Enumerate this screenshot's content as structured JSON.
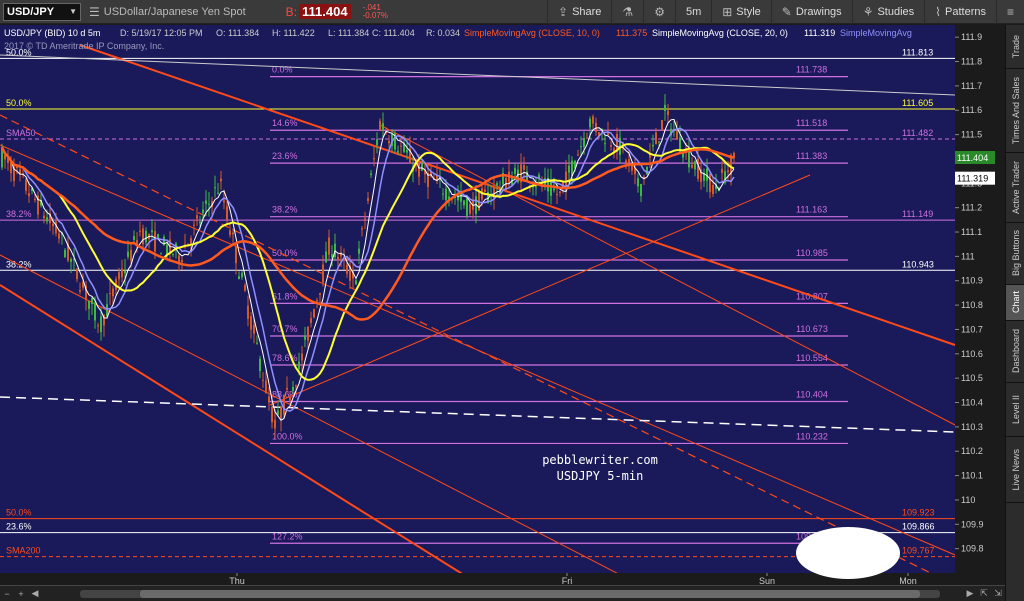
{
  "toolbar": {
    "symbol": "USD/JPY",
    "description": "USDollar/Japanese Yen Spot",
    "bid_label": "B:",
    "bid_value": "111.404",
    "change_net": "-.041",
    "change_pct": "-0.07%",
    "share_label": "Share",
    "timeframe_label": "5m",
    "style_label": "Style",
    "drawings_label": "Drawings",
    "studies_label": "Studies",
    "patterns_label": "Patterns",
    "icons": [
      "menu-icon",
      "share-icon",
      "flask-icon",
      "gear-icon",
      "style-icon",
      "pencil-icon",
      "studies-icon",
      "patterns-icon"
    ]
  },
  "chart": {
    "header": {
      "symbol": "USD/JPY (BID) 10 d 5m",
      "date": "D: 5/19/17 12:05 PM",
      "open": "O: 111.384",
      "high": "H: 111.422",
      "low": "L: 111.384",
      "close": "C: 111.404",
      "range": "R: 0.034",
      "sma10": "SimpleMovingAvg (CLOSE, 10, 0)",
      "sma10_value": "111.375",
      "sma20": "SimpleMovingAvg (CLOSE, 20, 0)",
      "sma20_value": "111.319",
      "sma_more": "SimpleMovingAvg"
    },
    "copyright": "2017 © TD Ameritrade IP Company, Inc.",
    "watermark_line1": "pebblewriter.com",
    "watermark_line2": "USDJPY 5-min",
    "colors": {
      "background": "#1a1a5a",
      "up_candle": "#3fb83f",
      "down_candle": "#d45a26",
      "sma10": "#ffffff",
      "sma20": "#9090ff",
      "sma50": "#ffff33",
      "sma200": "#ff5a1f",
      "fib": "#d070e0",
      "orange_lines": "#ff4a1a"
    },
    "y_axis": {
      "min": 109.7,
      "max": 111.95,
      "ticks": [
        "111.9",
        "111.8",
        "111.7",
        "111.6",
        "111.5",
        "111.4",
        "111.3",
        "111.2",
        "111.1",
        "111",
        "110.9",
        "110.8",
        "110.7",
        "110.6",
        "110.5",
        "110.4",
        "110.3",
        "110.2",
        "110.1",
        "110",
        "109.9",
        "109.8"
      ],
      "tick_values": [
        111.9,
        111.8,
        111.7,
        111.6,
        111.5,
        111.4,
        111.3,
        111.2,
        111.1,
        111.0,
        110.9,
        110.8,
        110.7,
        110.6,
        110.5,
        110.4,
        110.3,
        110.2,
        110.1,
        110.0,
        109.9,
        109.8
      ],
      "current_price": "111.404",
      "current_price_value": 111.404,
      "sma_price": "111.319",
      "sma_price_value": 111.319
    },
    "x_axis": {
      "labels": [
        "Thu",
        "Fri",
        "Sun",
        "Mon"
      ]
    },
    "fib_levels": [
      {
        "pct": "0.0%",
        "price": "111.738",
        "value": 111.738
      },
      {
        "pct": "14.6%",
        "price": "111.518",
        "value": 111.518
      },
      {
        "pct": "23.6%",
        "price": "111.383",
        "value": 111.383
      },
      {
        "pct": "38.2%",
        "price": "111.163",
        "value": 111.163
      },
      {
        "pct": "50.0%",
        "price": "110.985",
        "value": 110.985
      },
      {
        "pct": "61.8%",
        "price": "110.807",
        "value": 110.807
      },
      {
        "pct": "70.7%",
        "price": "110.673",
        "value": 110.673
      },
      {
        "pct": "78.6%",
        "price": "110.554",
        "value": 110.554
      },
      {
        "pct": "88.6%",
        "price": "110.404",
        "value": 110.404
      },
      {
        "pct": "100.0%",
        "price": "110.232",
        "value": 110.232
      },
      {
        "pct": "127.2%",
        "price": "109.822",
        "value": 109.822
      }
    ],
    "left_levels": [
      {
        "pct": "50.0%",
        "price": "111.813",
        "value": 111.813,
        "color": "#ffffff"
      },
      {
        "pct": "50.0%",
        "price": "111.605",
        "value": 111.605,
        "color": "#ffff33"
      },
      {
        "pct": "SMA50",
        "price": "111.482",
        "value": 111.482,
        "color": "#d070e0"
      },
      {
        "pct": "38.2%",
        "price": "111.149",
        "value": 111.149,
        "color": "#d070e0"
      },
      {
        "pct": "38.2%",
        "price": "110.943",
        "value": 110.943,
        "color": "#ffffff"
      },
      {
        "pct": "50.0%",
        "price": "109.923",
        "value": 109.923,
        "color": "#ff4a1a"
      },
      {
        "pct": "23.6%",
        "price": "109.866",
        "value": 109.866,
        "color": "#ffffff"
      },
      {
        "pct": "SMA200",
        "price": "109.767",
        "value": 109.767,
        "color": "#ff4a1a"
      }
    ]
  },
  "side_tabs": [
    "Trade",
    "Times And Sales",
    "Active Trader",
    "Big Buttons",
    "Chart",
    "Dashboard",
    "Level II",
    "Live News"
  ],
  "active_side_tab": "Chart",
  "bottom_bar": {
    "left_icons": [
      "zoom-out-icon",
      "zoom-in-icon"
    ],
    "right_icons": [
      "expand-icon",
      "collapse-icon"
    ]
  }
}
